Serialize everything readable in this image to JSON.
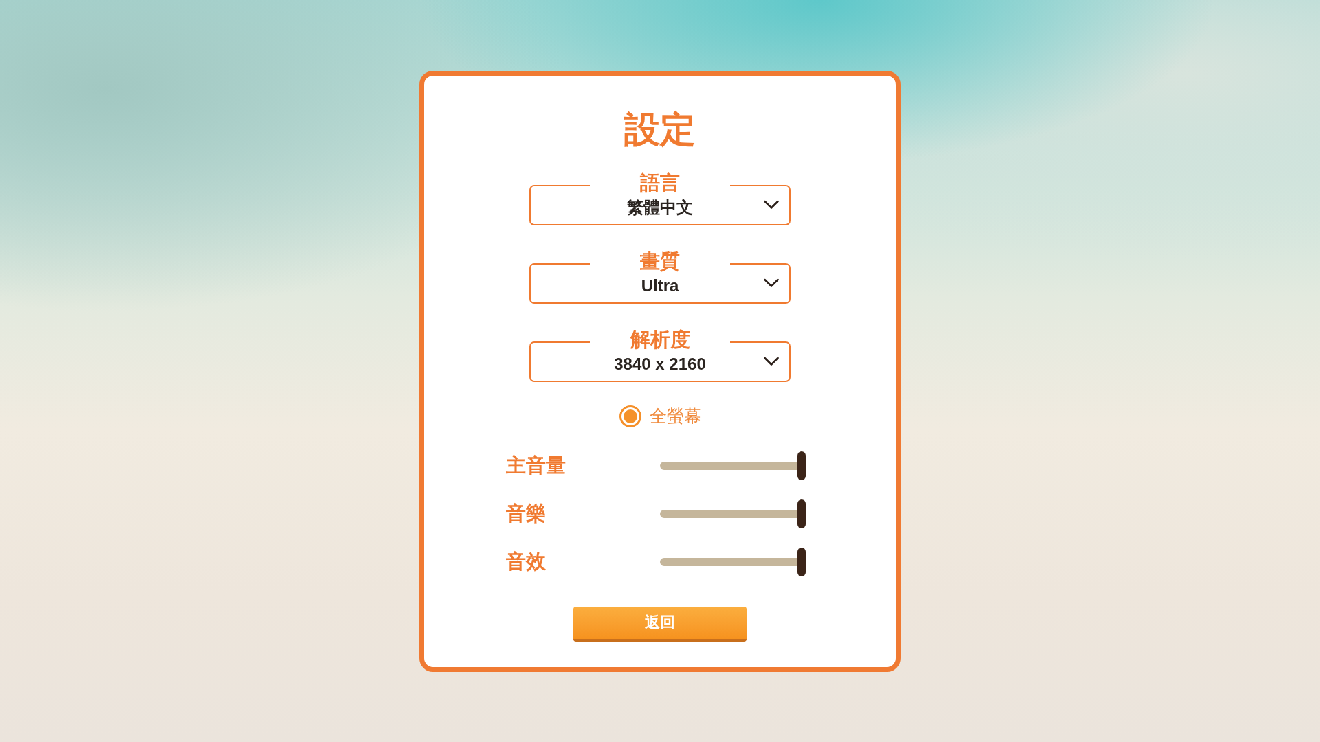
{
  "title": "設定",
  "dropdowns": [
    {
      "label": "語言",
      "value": "繁體中文"
    },
    {
      "label": "畫質",
      "value": "Ultra"
    },
    {
      "label": "解析度",
      "value": "3840 x 2160"
    }
  ],
  "fullscreen": {
    "label": "全螢幕",
    "checked": true
  },
  "sliders": [
    {
      "label": "主音量",
      "level": 1
    },
    {
      "label": "音樂",
      "level": 1
    },
    {
      "label": "音效",
      "level": 1
    }
  ],
  "buttons": [
    "返回"
  ]
}
